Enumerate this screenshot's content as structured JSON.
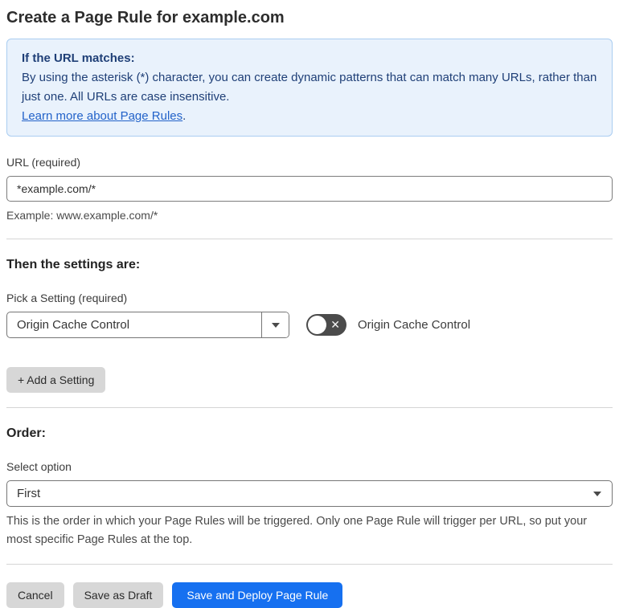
{
  "page": {
    "title": "Create a Page Rule for example.com"
  },
  "info_box": {
    "heading": "If the URL matches:",
    "body": "By using the asterisk (*) character, you can create dynamic patterns that can match many URLs, rather than just one. All URLs are case insensitive.",
    "link": "Learn more about Page Rules",
    "link_suffix": "."
  },
  "url_section": {
    "label": "URL (required)",
    "value": "*example.com/*",
    "helper": "Example: www.example.com/*"
  },
  "settings_section": {
    "heading": "Then the settings are:",
    "picker_label": "Pick a Setting (required)",
    "picker_value": "Origin Cache Control",
    "toggle_state": "off",
    "toggle_x_glyph": "✕",
    "toggle_caption": "Origin Cache Control",
    "add_button_label": "+ Add a Setting"
  },
  "order_section": {
    "heading": "Order:",
    "select_label": "Select option",
    "select_value": "First",
    "helper": "This is the order in which your Page Rules will be triggered. Only one Page Rule will trigger per URL, so put your most specific Page Rules at the top."
  },
  "footer": {
    "cancel_label": "Cancel",
    "save_draft_label": "Save as Draft",
    "save_deploy_label": "Save and Deploy Page Rule"
  },
  "colors": {
    "info_bg": "#e9f2fc",
    "info_border": "#aacdf1",
    "info_text": "#1f3f77",
    "link_blue": "#2262c9",
    "primary_button_blue": "#1670f0",
    "gray_button": "#d7d7d7",
    "toggle_off_bg": "#4b4b4b"
  }
}
